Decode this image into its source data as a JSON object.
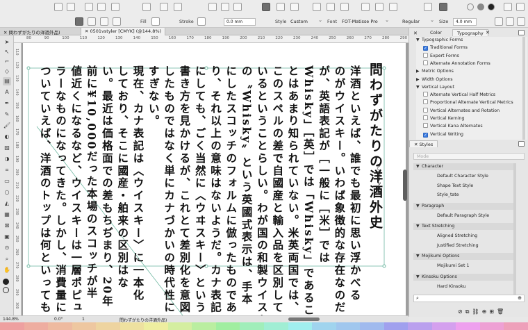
{
  "toolbar": {
    "fill_label": "Fill",
    "stroke_label": "Stroke",
    "stroke_width": "0.0 mm",
    "style_label": "Style",
    "style_value": "Custom",
    "font_label": "Font",
    "font_value": "FOT-Matisse Pro",
    "weight_value": "Regular",
    "size_label": "Size",
    "size_value": "4.0 mm"
  },
  "tabs": [
    {
      "label": "問わずがたりの洋酒外品)"
    },
    {
      "label": "0501vstyler [CMYK] (@144.8%)"
    }
  ],
  "ruler": {
    "h_ticks": [
      "80",
      "90",
      "100",
      "110",
      "120",
      "130",
      "140",
      "150",
      "160",
      "170",
      "180",
      "190",
      "200",
      "210",
      "220",
      "230",
      "240",
      "250",
      "260",
      "270",
      "280",
      "290"
    ],
    "v_ticks": [
      "110",
      "120",
      "130",
      "140",
      "150",
      "160",
      "170",
      "180",
      "190",
      "200",
      "210",
      "220",
      "230",
      "240",
      "250",
      "260",
      "270",
      "280",
      "290",
      "300"
    ]
  },
  "document": {
    "columns": [
      "問わずがたりの洋酒外史",
      "洋酒といえば、誰でも最初に思い浮かべる",
      "のがウイスキー。いわば象徴的な存在なのだ",
      "が、英語表記が［一般に［米］では",
      "Whisky」［英］では「Whisky」であるこ",
      "とはあまり知られていない。米英両国では、",
      "このスペルの差で自國産と輸入品を区別して",
      "いるということらしい。わが国の和製ウイスキー",
      "の〝Whisky〟という英國式表示は、手本",
      "にしたスコッチのフォルムに倣ったものであ",
      "り、それ以上の意味はないようだ。カナ表記",
      "にしても、ごく当然に〈ウヰスキー〉という",
      "書き方を見かけるが、これとて差別化を意図",
      "したものではなく単にカナづかいの時代性に",
      "すぎない。",
      "現在、カナ表記は〈ウイスキー〉に一本化",
      "しており、そこに國産・舶来の区別はな",
      "い。最近は価格面での差もちぢまり、20年",
      "前に¥10,000だった本場のスコッチが半",
      "値近くになるなど、ウイスキーは一層ポピュ",
      "ラーなものになってきた。しかし、消費量に",
      "ついていえば、洋酒のトップは何といっても"
    ],
    "ruby_note": "シンボリック的"
  },
  "panel": {
    "tabs": [
      "Color",
      "Typography"
    ],
    "typography": [
      {
        "label": "Typographic Forms",
        "type": "group",
        "open": true
      },
      {
        "label": "Traditional Forms",
        "type": "check",
        "on": true
      },
      {
        "label": "Expert Forms",
        "type": "check",
        "on": false
      },
      {
        "label": "Alternate Annotation Forms",
        "type": "check",
        "on": false
      },
      {
        "label": "Metric Options",
        "type": "group",
        "open": false
      },
      {
        "label": "Width Options",
        "type": "group",
        "open": false
      },
      {
        "label": "Vertical Layout",
        "type": "group",
        "open": true
      },
      {
        "label": "Alternate Vertical Half Metrics",
        "type": "check",
        "on": false
      },
      {
        "label": "Proportional Alternate Vertical Metrics",
        "type": "check",
        "on": false
      },
      {
        "label": "Vertical Alternates and Rotation",
        "type": "check",
        "on": false
      },
      {
        "label": "Vertical Kerning",
        "type": "check",
        "on": false
      },
      {
        "label": "Vertical Kana Alternates",
        "type": "check",
        "on": false
      },
      {
        "label": "Vertical Writing",
        "type": "check",
        "on": true
      }
    ],
    "styles_tab": "Styles",
    "mode_placeholder": "Mode",
    "style_groups": [
      {
        "label": "Character",
        "items": [
          "Default Character Style",
          "Shape Text Style",
          "Style_tate"
        ]
      },
      {
        "label": "Paragraph",
        "items": [
          "Default Paragraph Style"
        ]
      },
      {
        "label": "Text Stretching",
        "items": [
          "Aligned Stretching",
          "Justified Stretching"
        ]
      },
      {
        "label": "Mojikumi Options",
        "items": [
          "Mojikumi Set 1"
        ]
      },
      {
        "label": "Kinsoku Options",
        "items": [
          "Hard Kinsoku"
        ]
      }
    ]
  },
  "status": {
    "zoom": "144.8%",
    "angle": "0.0°",
    "page": "1",
    "layer": "問わずがたりの洋酒外品)"
  },
  "colors": {
    "accent": "#3a7be0",
    "frame": "#6fb8a2"
  }
}
